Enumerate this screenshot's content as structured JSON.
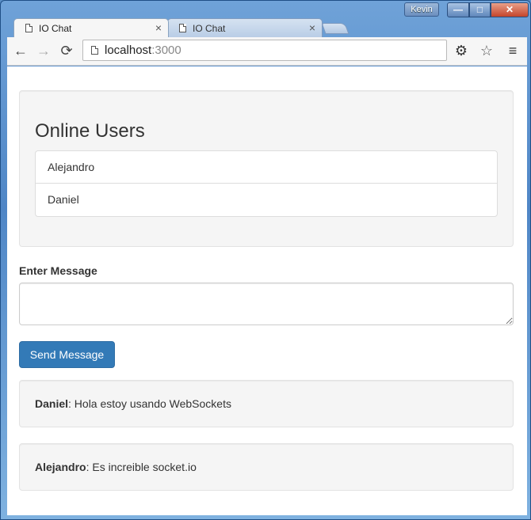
{
  "window": {
    "user_badge": "Kevin",
    "minimize_glyph": "—",
    "maximize_glyph": "□",
    "close_glyph": "✕"
  },
  "tabs": [
    {
      "title": "IO Chat",
      "active": true,
      "close": "×"
    },
    {
      "title": "IO Chat",
      "active": false,
      "close": "×"
    }
  ],
  "toolbar": {
    "back_icon": "←",
    "forward_icon": "→",
    "reload_icon": "⟳",
    "url_host": "localhost",
    "url_port": ":3000",
    "settings_icon": "⚙",
    "bookmark_icon": "☆",
    "menu_icon": "≡"
  },
  "online_users": {
    "title": "Online Users",
    "users": [
      "Alejandro",
      "Daniel"
    ]
  },
  "message_form": {
    "label": "Enter Message",
    "value": "",
    "send_label": "Send Message"
  },
  "chat": [
    {
      "user": "Daniel",
      "text": ": Hola estoy usando WebSockets"
    },
    {
      "user": "Alejandro",
      "text": ": Es increible socket.io"
    }
  ],
  "colors": {
    "primary_button": "#337ab7",
    "well_background": "#f5f5f5",
    "titlebar": "#4f86c6"
  }
}
